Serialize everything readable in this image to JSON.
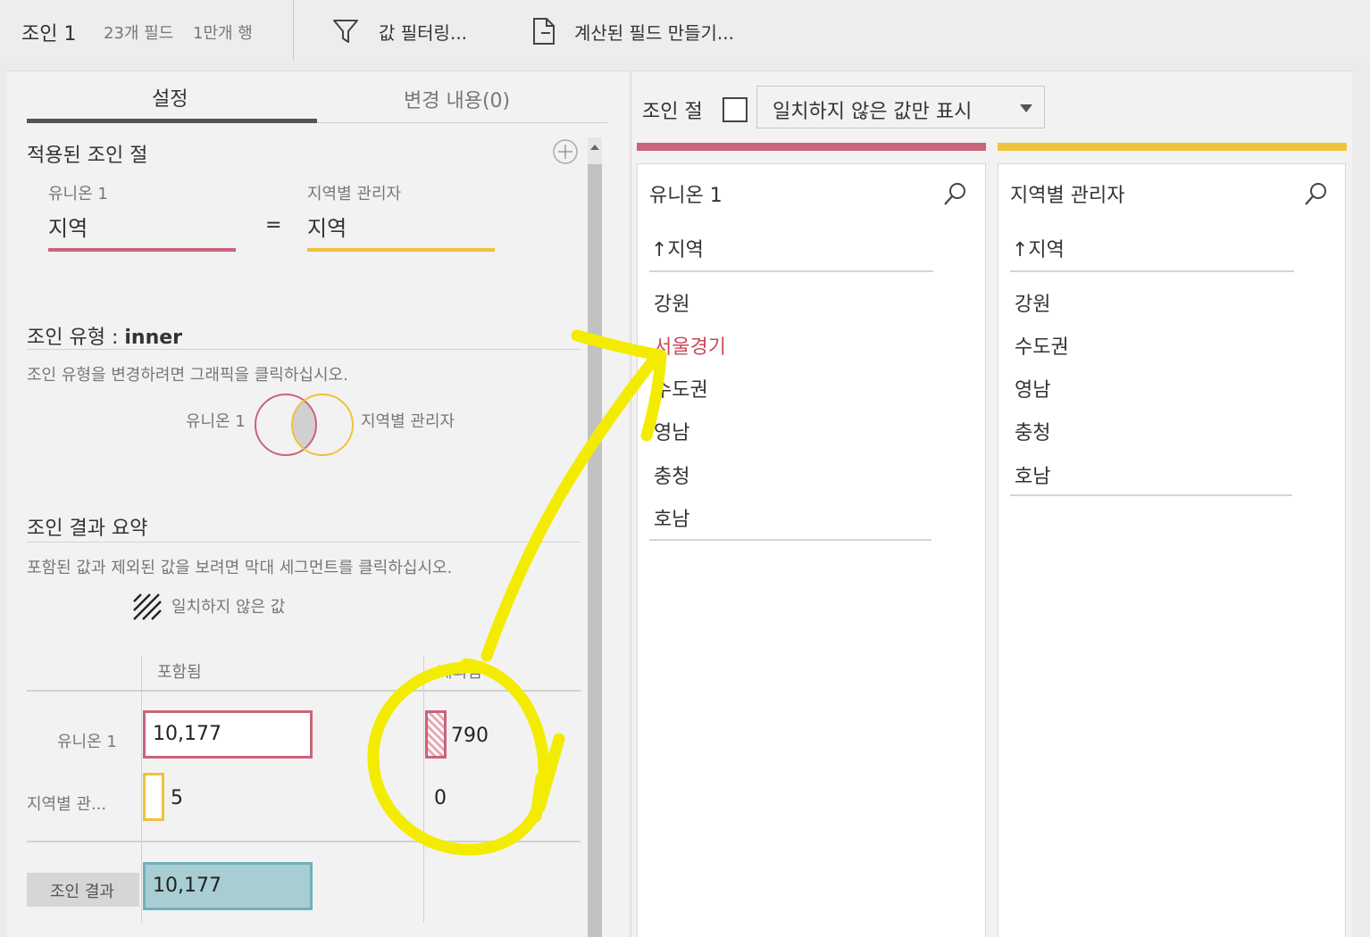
{
  "toolbar": {
    "title": "조인 1",
    "fields": "23개 필드",
    "rows": "1만개 행",
    "filter_label": "값 필터링...",
    "calc_label": "계산된 필드 만들기..."
  },
  "left": {
    "tabs": {
      "settings": "설정",
      "changes": "변경 내용(0)"
    },
    "applied": {
      "title": "적용된 조인 절",
      "left_source": "유니온 1",
      "right_source": "지역별 관리자",
      "left_field": "지역",
      "operator": "=",
      "right_field": "지역"
    },
    "join_type": {
      "title_prefix": "조인 유형 : ",
      "type": "inner",
      "hint": "조인 유형을 변경하려면 그래픽을 클릭하십시오.",
      "venn_left": "유니온 1",
      "venn_right": "지역별 관리자"
    },
    "summary": {
      "title": "조인 결과 요약",
      "hint": "포함된 값과 제외된 값을 보려면 막대 세그먼트를 클릭하십시오.",
      "legend": "일치하지 않은 값",
      "col_included": "포함됨",
      "col_excluded": "제외됨",
      "rows": [
        {
          "label": "유니온 1",
          "included": "10,177",
          "excluded": "790"
        },
        {
          "label": "지역별 관...",
          "included": "5",
          "excluded": "0"
        }
      ],
      "result_label": "조인 결과",
      "result_value": "10,177"
    }
  },
  "right": {
    "join_clause_label": "조인 절",
    "dropdown_value": "일치하지 않은 값만 표시",
    "left_card": {
      "title": "유니온 1",
      "column": "↑지역",
      "items": [
        "강원",
        "서울경기",
        "수도권",
        "영남",
        "충청",
        "호남"
      ],
      "highlighted": "서울경기"
    },
    "right_card": {
      "title": "지역별 관리자",
      "column": "↑지역",
      "items": [
        "강원",
        "수도권",
        "영남",
        "충청",
        "호남"
      ]
    }
  },
  "colors": {
    "left_accent": "#c9647a",
    "right_accent": "#efc23b",
    "result_fill": "#a8cdd3",
    "result_border": "#6fb1bc",
    "annotation": "#f4ec00"
  }
}
